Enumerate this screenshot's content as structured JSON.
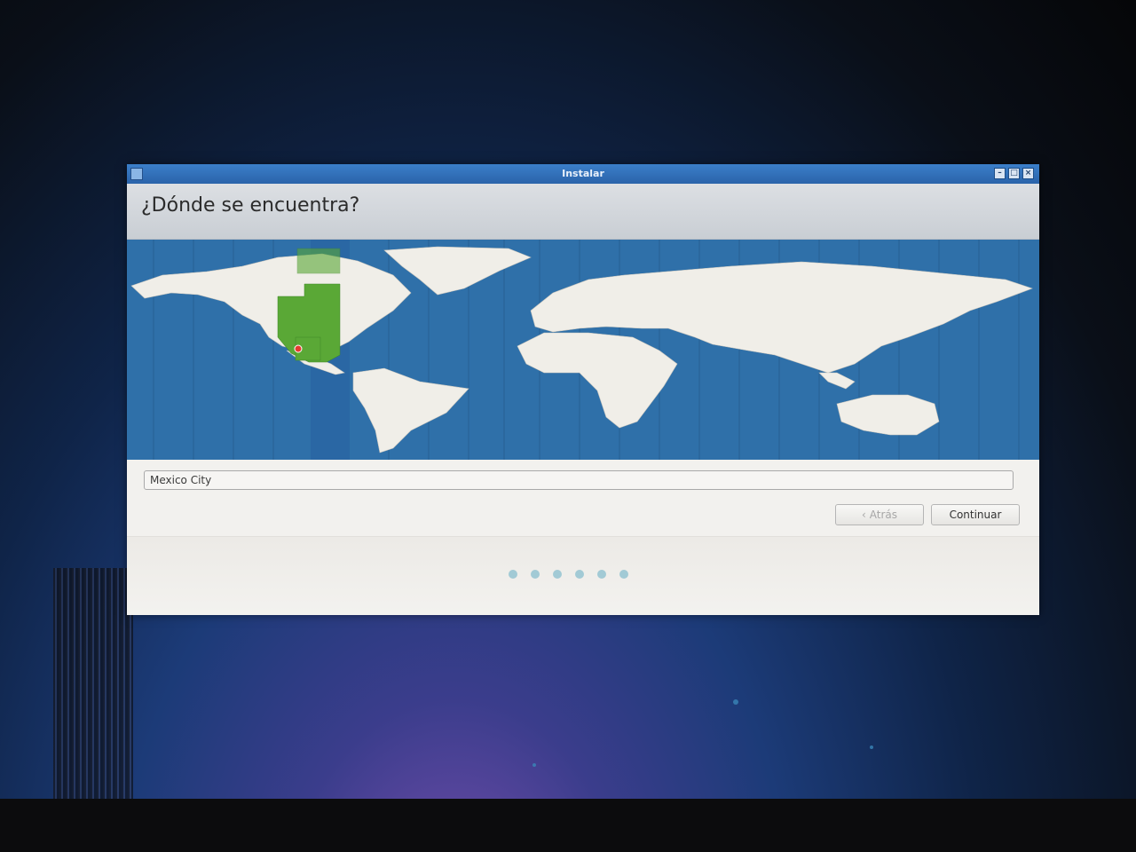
{
  "window": {
    "title": "Instalar",
    "controls": [
      "minimize",
      "maximize",
      "close"
    ]
  },
  "header": {
    "title": "¿Dónde se encuentra?"
  },
  "map": {
    "selected_city_marker": "red-circle",
    "highlight_color": "#5aa836"
  },
  "timezone_input": {
    "value": "Mexico City"
  },
  "buttons": {
    "back_label": "Atrás",
    "back_icon": "chevron-left-icon",
    "continue_label": "Continuar"
  },
  "progress": {
    "total_steps": 6
  },
  "colors": {
    "titlebar": "#2a63aa",
    "ocean": "#2e6fa8",
    "land": "#f0eee8"
  }
}
